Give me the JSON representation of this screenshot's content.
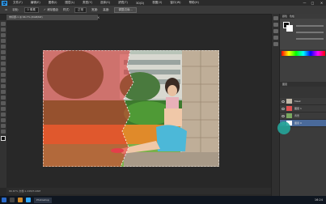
{
  "menubar": {
    "logo": "Ps",
    "items": [
      "文件(F)",
      "编辑(E)",
      "图像(I)",
      "图层(L)",
      "类型(Y)",
      "选择(S)",
      "滤镜(T)",
      "3D(D)",
      "视图(V)",
      "窗口(W)",
      "帮助(H)"
    ],
    "minimize": "—",
    "maximize": "□",
    "close": "✕"
  },
  "options": {
    "feather_label": "羽化:",
    "feather_value": "0 像素",
    "antialias_label": "✓ 消除锯齿",
    "style_label": "样式:",
    "style_value": "正常",
    "width_label": "宽度:",
    "height_label": "高度:",
    "refine_edge": "调整边缘..."
  },
  "document": {
    "tab_title": "未标题-1 @ 66.7% (RGB/8#)",
    "tab_close": "×",
    "status_text": "66.67%    文档:1.24M/3.46M"
  },
  "panels": {
    "tabs": [
      "颜色",
      "色板"
    ],
    "layers_tab": "图层",
    "layers": [
      {
        "name": "Mask",
        "thumb_color": "#c0b8a8"
      },
      {
        "name": "图层 1",
        "thumb_color": "#e05050"
      },
      {
        "name": "背景",
        "thumb_color": "#7aa860"
      },
      {
        "name": "图层 0",
        "thumb_color": "#ffffff"
      }
    ]
  },
  "taskbar": {
    "task_label": "Photoshop",
    "time": "16:24"
  },
  "colors": {
    "red_overlay": "#e03030",
    "accent_circle": "#25a59a",
    "ps_blue": "#31a8ff"
  }
}
